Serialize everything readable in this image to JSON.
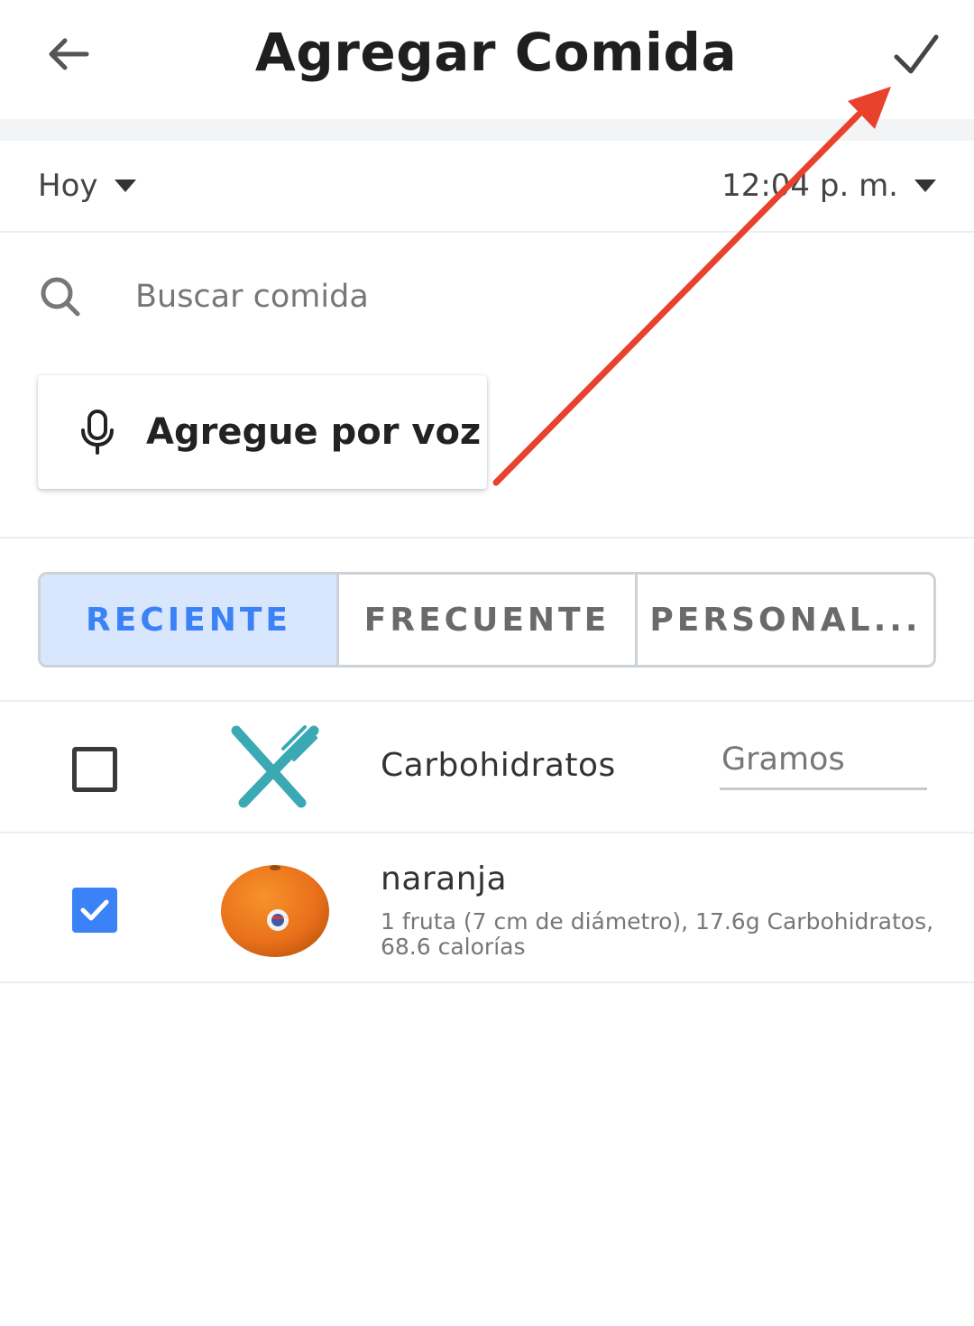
{
  "header": {
    "title": "Agregar Comida",
    "back_icon": "arrow-left-icon",
    "done_icon": "check-icon"
  },
  "date_row": {
    "date_value": "Hoy",
    "time_value": "12:04 p. m."
  },
  "search": {
    "placeholder": "Buscar comida",
    "value": ""
  },
  "voice_button": {
    "label": "Agregue por voz",
    "icon": "microphone-icon"
  },
  "tabs": [
    {
      "label": "RECIENTE",
      "active": true
    },
    {
      "label": "FRECUENTE",
      "active": false
    },
    {
      "label": "PERSONAL...",
      "active": false
    }
  ],
  "food_list": [
    {
      "name": "Carbohidratos",
      "checked": false,
      "icon": "cutlery-icon",
      "amount_placeholder": "Gramos"
    },
    {
      "name": "naranja",
      "checked": true,
      "icon": "orange-image",
      "description": "1 fruta (7 cm de diámetro), 17.6g Carbohidratos, 68.6 calorías"
    }
  ],
  "colors": {
    "accent": "#3b82f6",
    "tab_active_bg": "#d8e7fd",
    "icon_teal": "#3aa9b4",
    "annotation_arrow": "#e8412c"
  }
}
